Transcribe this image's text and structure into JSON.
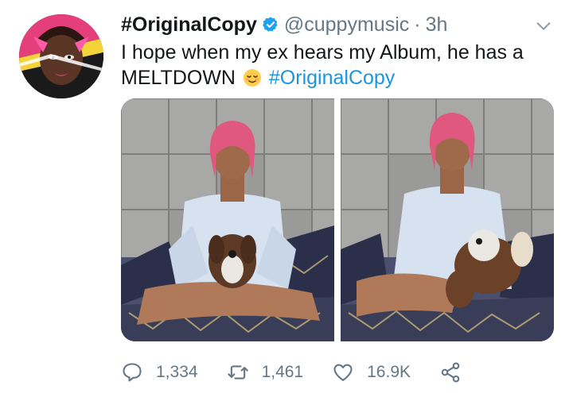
{
  "tweet": {
    "display_name": "#OriginalCopy",
    "handle": "@cuppymusic",
    "separator": "·",
    "time": "3h",
    "text_main": "I hope when my ex hears my Album, he has a MELTDOWN",
    "emoji": "relieved-face",
    "hashtag": "#OriginalCopy",
    "images": [
      "photo-woman-with-teddy-1",
      "photo-woman-with-teddy-2"
    ]
  },
  "actions": {
    "replies": "1,334",
    "retweets": "1,461",
    "likes": "16.9K"
  },
  "colors": {
    "text": "#14171a",
    "secondary": "#657786",
    "link": "#1b95e0",
    "verified": "#1da1f2"
  }
}
